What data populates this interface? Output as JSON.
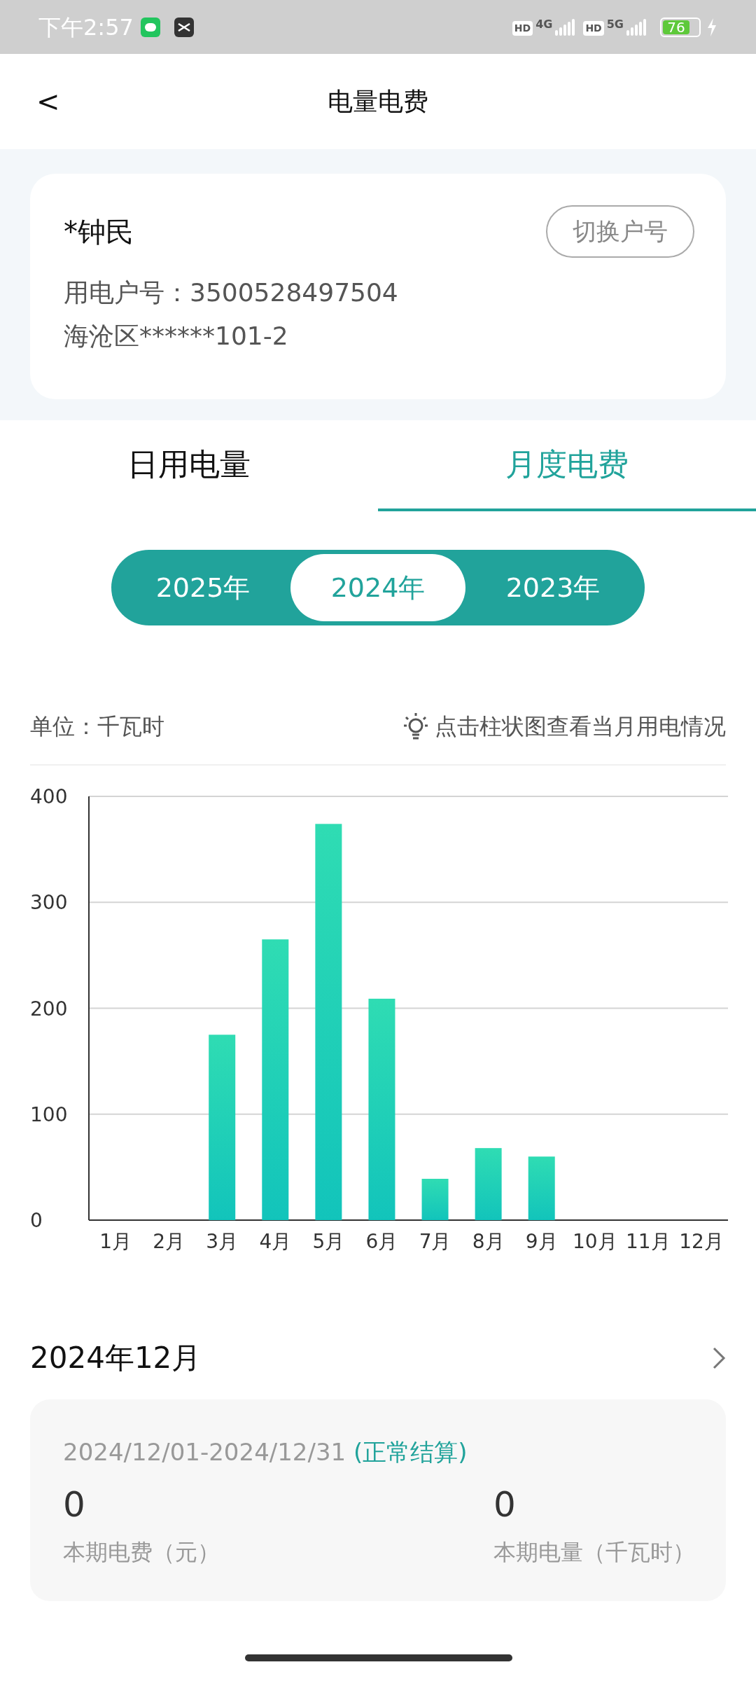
{
  "status_bar": {
    "time": "下午2:57",
    "network_badges": [
      "HD",
      "HD"
    ],
    "network_types": [
      "4G",
      "5G"
    ],
    "battery": "76"
  },
  "header": {
    "back": "<",
    "title": "电量电费"
  },
  "account": {
    "name": "*钟民",
    "switch_button": "切换户号",
    "account_number": "用电户号：3500528497504",
    "address": "海沧区******101-2"
  },
  "tabs": [
    {
      "label": "日用电量",
      "selected": false
    },
    {
      "label": "月度电费",
      "selected": true
    }
  ],
  "years": [
    {
      "label": "2025年",
      "selected": false
    },
    {
      "label": "2024年",
      "selected": true
    },
    {
      "label": "2023年",
      "selected": false
    }
  ],
  "unit": "单位：千瓦时",
  "hint": "点击柱状图查看当月用电情况",
  "chart_data": {
    "type": "bar",
    "categories": [
      "1月",
      "2月",
      "3月",
      "4月",
      "5月",
      "6月",
      "7月",
      "8月",
      "9月",
      "10月",
      "11月",
      "12月"
    ],
    "values": [
      0,
      0,
      175,
      265,
      374,
      209,
      39,
      68,
      60,
      0,
      0,
      0
    ],
    "ylim": [
      0,
      400
    ],
    "grid": true,
    "yticks": [
      0,
      100,
      200,
      300,
      400
    ]
  },
  "bill": {
    "month": "2024年12月",
    "period": "2024/12/01-2024/12/31",
    "status": "(正常结算)",
    "fee": "0",
    "fee_label": "本期电费（元）",
    "usage": "0",
    "usage_label": "本期电量（千瓦时）"
  }
}
